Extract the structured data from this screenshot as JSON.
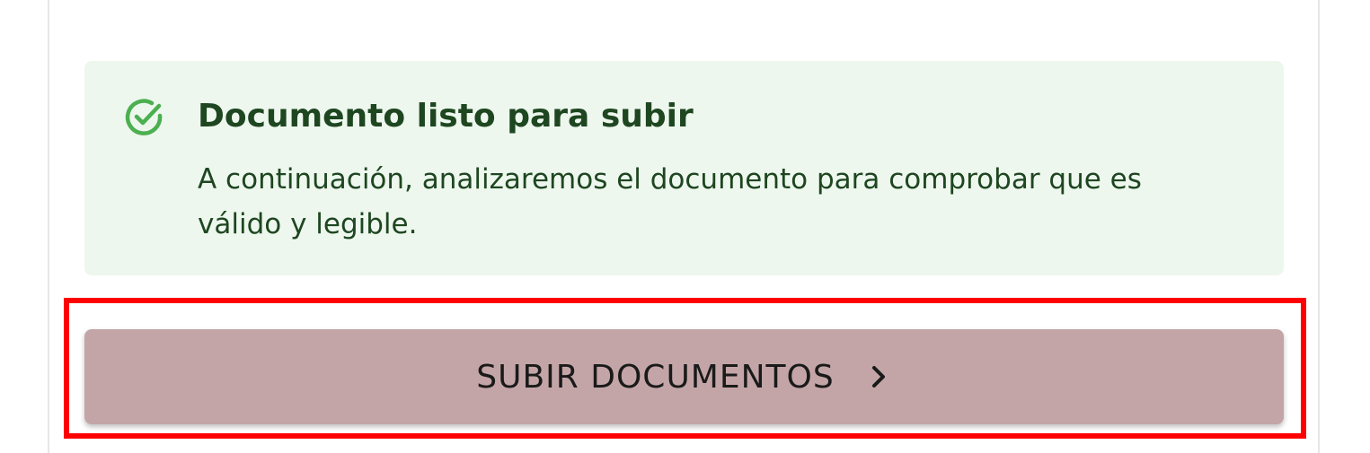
{
  "alert": {
    "icon": "check-circle-icon",
    "title": "Documento listo para subir",
    "body": "A continuación, analizaremos el documento para comprobar que es válido y legible.",
    "colors": {
      "background": "#edf7ee",
      "icon": "#4caf50",
      "text": "#1e4620"
    }
  },
  "upload_button": {
    "label": "SUBIR DOCUMENTOS",
    "icon": "chevron-right-icon",
    "background": "#c4a5a7"
  },
  "highlight": {
    "color": "#ff0000"
  }
}
